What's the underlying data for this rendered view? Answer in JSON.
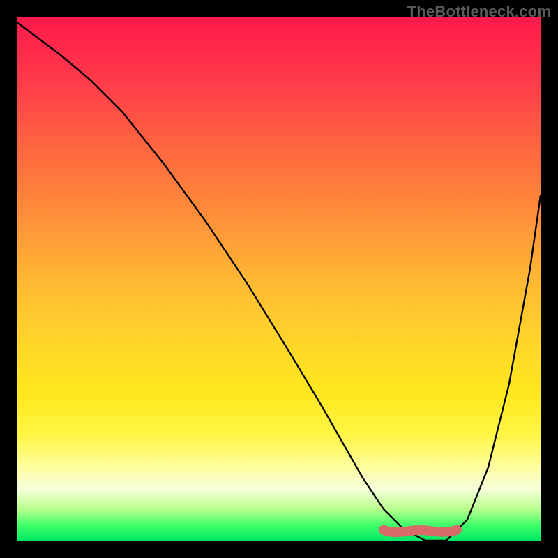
{
  "watermark": "TheBottleneck.com",
  "chart_data": {
    "type": "line",
    "title": "",
    "xlabel": "",
    "ylabel": "",
    "xlim": [
      0,
      100
    ],
    "ylim": [
      0,
      100
    ],
    "grid": false,
    "legend": false,
    "background_gradient": {
      "top": "#ff1a4b",
      "mid_upper": "#ff8f3a",
      "mid": "#ffe81e",
      "mid_lower": "#fffea0",
      "bottom": "#00e865"
    },
    "series": [
      {
        "name": "bottleneck-curve",
        "color": "#000000",
        "x": [
          0,
          4,
          8,
          14,
          20,
          28,
          36,
          44,
          52,
          58,
          62,
          66,
          70,
          74,
          78,
          82,
          86,
          90,
          94,
          98,
          100
        ],
        "y": [
          99,
          96,
          93,
          88,
          82,
          72,
          61,
          49,
          36,
          26,
          19,
          12,
          6,
          2,
          0,
          0,
          4,
          14,
          30,
          52,
          66
        ]
      }
    ],
    "minimum_region": {
      "name": "min-marker",
      "color": "#d86a6a",
      "x_start": 70,
      "x_end": 84,
      "y": 1
    }
  }
}
